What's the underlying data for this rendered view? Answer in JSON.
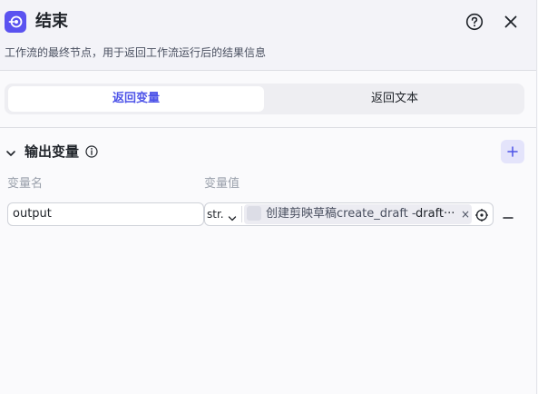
{
  "header": {
    "title": "结束",
    "description": "工作流的最终节点，用于返回工作流运行后的结果信息",
    "icon": "end-node-icon",
    "accent_color": "#5a52f0"
  },
  "tabs": [
    {
      "label": "返回变量",
      "active": true
    },
    {
      "label": "返回文本",
      "active": false
    }
  ],
  "output_section": {
    "title": "输出变量",
    "columns": {
      "name": "变量名",
      "value": "变量值"
    },
    "rows": [
      {
        "name": "output",
        "type": "str.",
        "ref_node": "创建剪映草稿create_draft",
        "ref_separator": "-",
        "ref_var": "draft···",
        "ref_close": "×"
      }
    ]
  },
  "colors": {
    "active_tab": "#4d53e8",
    "add_button_bg": "#e4e4fb"
  }
}
